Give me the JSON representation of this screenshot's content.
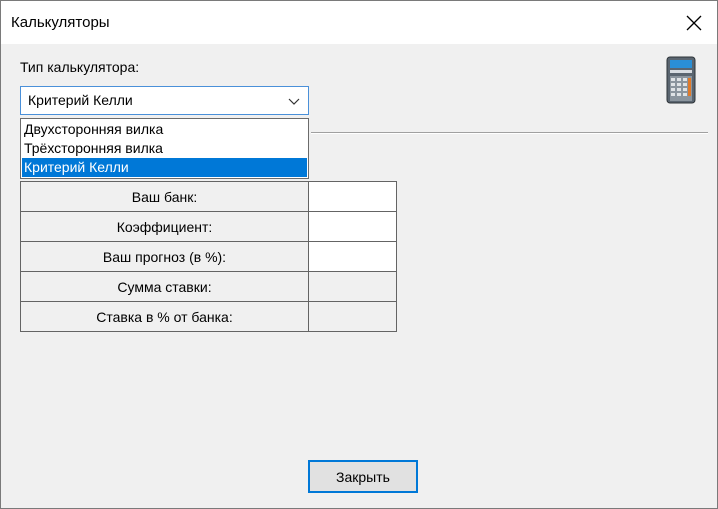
{
  "window": {
    "title": "Калькуляторы"
  },
  "calculator_type": {
    "label": "Тип калькулятора:",
    "selected": "Критерий Келли",
    "options": [
      "Двухсторонняя вилка",
      "Трёхсторонняя вилка",
      "Критерий Келли"
    ]
  },
  "kelly": {
    "rows": [
      {
        "label": "Ваш банк:",
        "value": ""
      },
      {
        "label": "Коэффициент:",
        "value": ""
      },
      {
        "label": "Ваш прогноз (в %):",
        "value": ""
      },
      {
        "label": "Сумма ставки:",
        "value": ""
      },
      {
        "label": "Ставка в % от банка:",
        "value": ""
      }
    ]
  },
  "footer": {
    "close_label": "Закрыть"
  },
  "colors": {
    "selection": "#0078d7",
    "window_bg": "#f0f0f0"
  },
  "icons": {
    "close": "close-icon",
    "dropdown": "chevron-down-icon",
    "app": "calculator-icon"
  }
}
